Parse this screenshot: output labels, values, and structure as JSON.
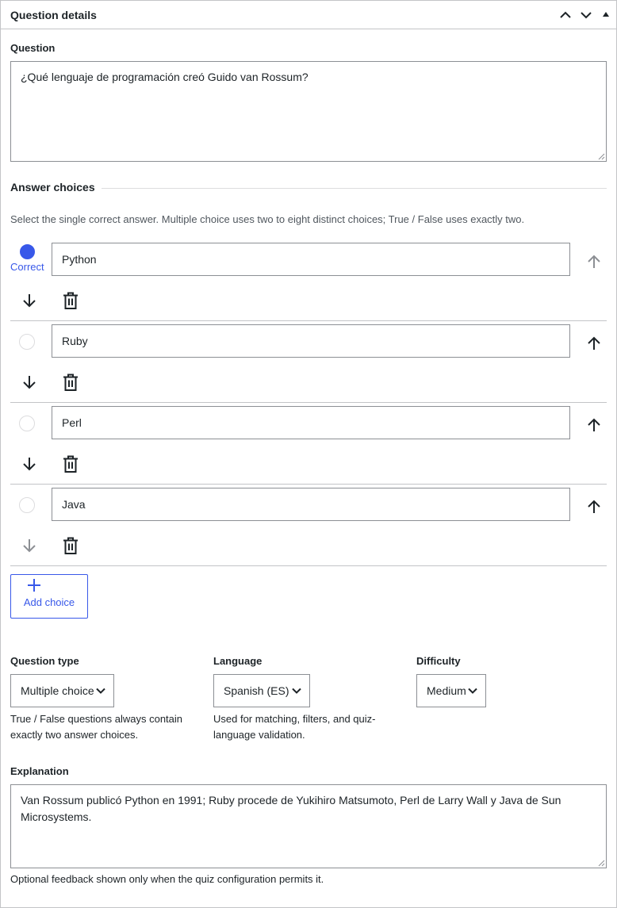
{
  "panel": {
    "title": "Question details"
  },
  "question": {
    "label": "Question",
    "value": "¿Qué lenguaje de programación creó Guido van Rossum?"
  },
  "answers": {
    "heading": "Answer choices",
    "help": "Select the single correct answer. Multiple choice uses two to eight distinct choices; True / False uses exactly two.",
    "correct_label": "Correct",
    "choices": [
      {
        "value": "Python",
        "correct": true
      },
      {
        "value": "Ruby",
        "correct": false
      },
      {
        "value": "Perl",
        "correct": false
      },
      {
        "value": "Java",
        "correct": false
      }
    ],
    "add_label": "Add choice"
  },
  "question_type": {
    "label": "Question type",
    "value": "Multiple choice",
    "help": "True / False questions always contain exactly two answer choices."
  },
  "language": {
    "label": "Language",
    "value": "Spanish (ES)",
    "help": "Used for matching, filters, and quiz-language validation."
  },
  "difficulty": {
    "label": "Difficulty",
    "value": "Medium"
  },
  "explanation": {
    "label": "Explanation",
    "value": "Van Rossum publicó Python en 1991; Ruby procede de Yukihiro Matsumoto, Perl de Larry Wall y Java de Sun Microsystems.",
    "help": "Optional feedback shown only when the quiz configuration permits it."
  },
  "colors": {
    "accent": "#3858e9",
    "border": "#8c8f94",
    "text": "#1d2327"
  },
  "icons": [
    "chevron-up-icon",
    "chevron-down-icon",
    "triangle-up-icon",
    "arrow-up-icon",
    "arrow-down-icon",
    "trash-icon",
    "plus-icon"
  ]
}
